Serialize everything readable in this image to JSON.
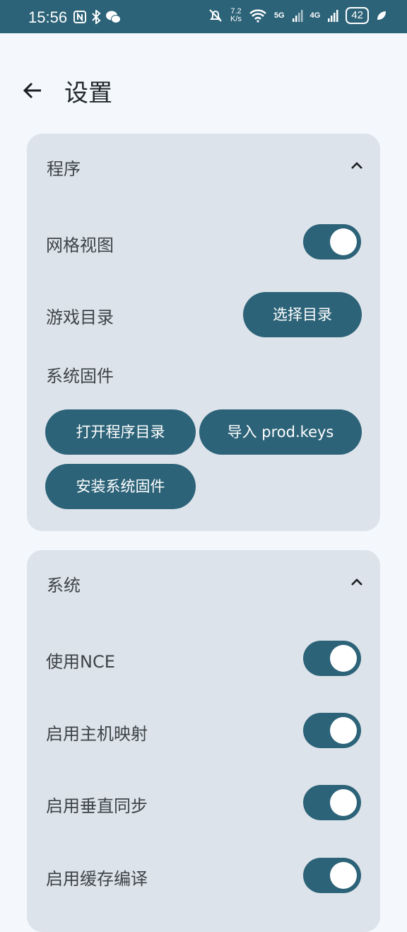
{
  "status_bar": {
    "time": "15:56",
    "left_icons": [
      "nfc-icon",
      "bluetooth-icon",
      "wechat-icon"
    ],
    "net_speed_value": "7.2",
    "net_speed_unit": "K/s",
    "net_5g": "5G",
    "net_4g": "4G",
    "battery": "42"
  },
  "header": {
    "title": "设置"
  },
  "sections": [
    {
      "title": "程序",
      "rows": {
        "grid_view": {
          "label": "网格视图",
          "on": true
        },
        "game_dir": {
          "label": "游戏目录",
          "button": "选择目录"
        },
        "firmware": {
          "label": "系统固件"
        }
      },
      "buttons": {
        "open_dir": "打开程序目录",
        "import_keys": "导入 prod.keys",
        "install_firmware": "安装系统固件"
      }
    },
    {
      "title": "系统",
      "toggles": [
        {
          "label": "使用NCE",
          "on": true
        },
        {
          "label": "启用主机映射",
          "on": true
        },
        {
          "label": "启用垂直同步",
          "on": true
        },
        {
          "label": "启用缓存编译",
          "on": true
        }
      ]
    }
  ],
  "colors": {
    "accent": "#2c6378",
    "card": "#dde3ea",
    "background": "#f4f7fb"
  }
}
